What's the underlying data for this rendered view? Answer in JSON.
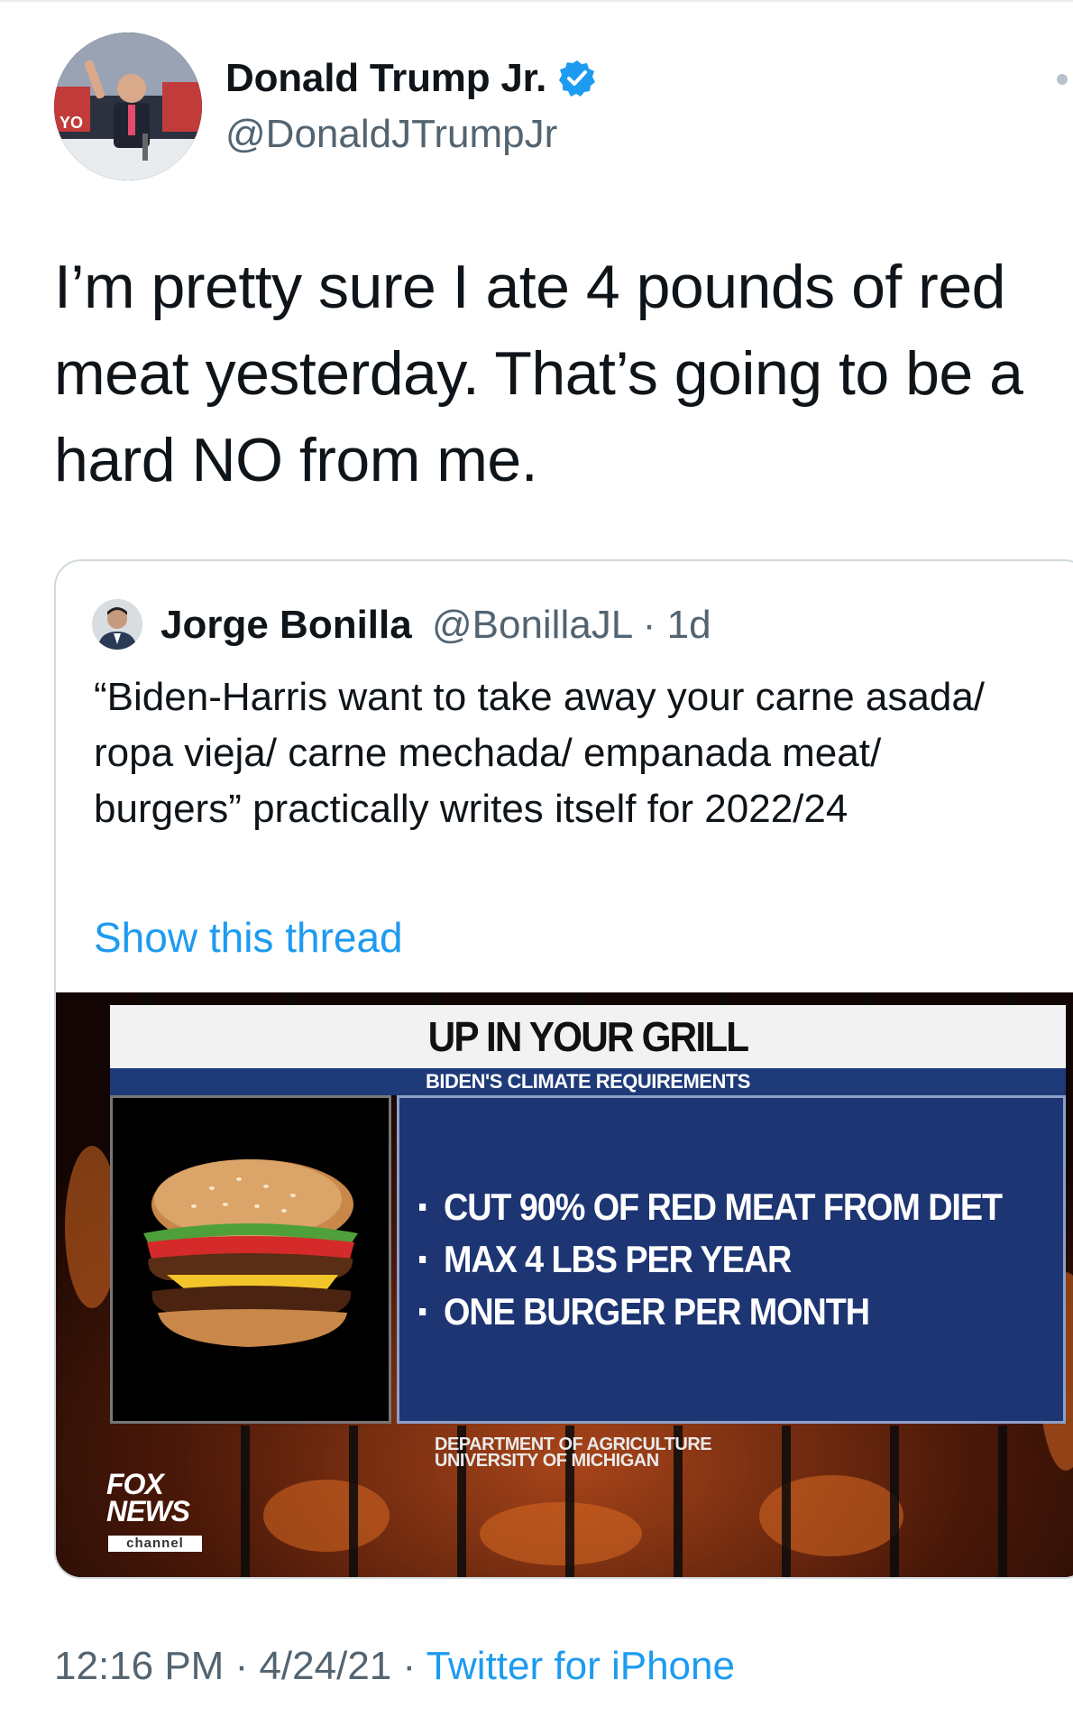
{
  "author": {
    "display_name": "Donald Trump Jr.",
    "handle": "@DonaldJTrumpJr",
    "verified": true,
    "verified_icon": "verified-badge-icon",
    "avatar_text": "YO"
  },
  "tweet": {
    "text": "I’m pretty sure I ate 4 pounds of red meat yesterday. That’s going to be a hard NO from me."
  },
  "quote": {
    "display_name": "Jorge Bonilla",
    "handle": "@BonillaJL",
    "separator": "·",
    "time": "1d",
    "text": "“Biden-Harris want to take away your carne asada/ ropa vieja/ carne mechada/ empanada meat/ burgers” practically writes itself for 2022/24",
    "show_thread": "Show this thread",
    "media": {
      "headline": "UP IN YOUR GRILL",
      "subheadline": "BIDEN'S CLIMATE REQUIREMENTS",
      "bullets": [
        "CUT 90% OF RED MEAT FROM DIET",
        "MAX 4 LBS PER YEAR",
        "ONE BURGER PER MONTH"
      ],
      "source_line1": "DEPARTMENT OF AGRICULTURE",
      "source_line2": "UNIVERSITY OF MICHIGAN",
      "logo_line1": "FOX",
      "logo_line2": "NEWS",
      "logo_line3": "channel"
    }
  },
  "footer": {
    "time": "12:16 PM",
    "sep1": " · ",
    "date": "4/24/21",
    "sep2": " · ",
    "source": "Twitter for iPhone"
  },
  "colors": {
    "link": "#1d9bf0",
    "secondary_text": "#536471",
    "fox_blue": "#1d3573"
  }
}
